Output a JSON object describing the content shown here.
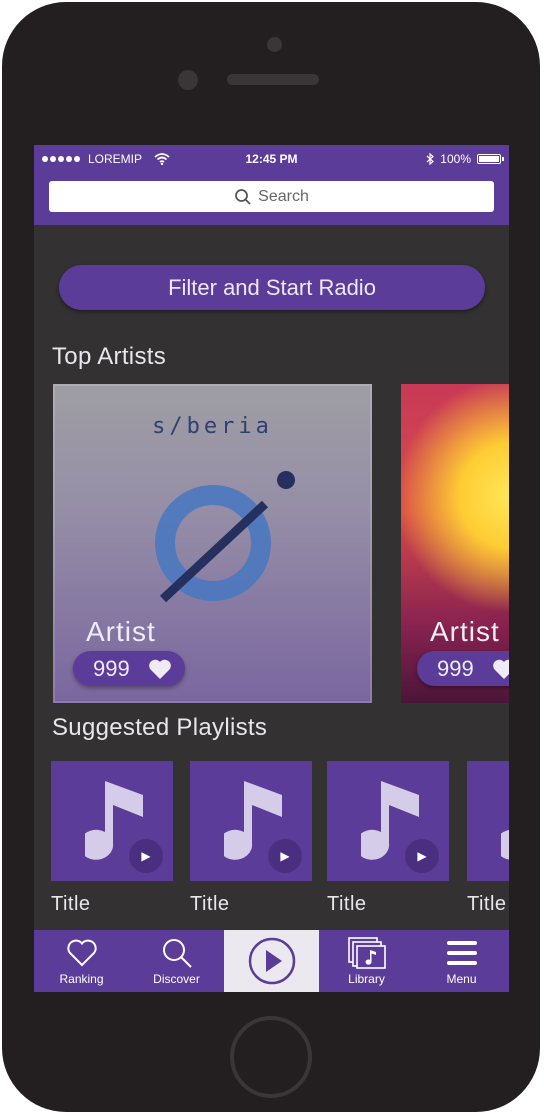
{
  "status_bar": {
    "carrier": "LOREMIP",
    "time": "12:45 PM",
    "battery": "100%",
    "battery_level": 1.0,
    "signal_bars": 5
  },
  "search": {
    "placeholder": "Search"
  },
  "filter_button": {
    "label": "Filter and Start Radio"
  },
  "top_artists": {
    "title": "Top Artists",
    "items": [
      {
        "name": "Artist",
        "likes": "999",
        "cover_text": "s/beria"
      },
      {
        "name": "Artist",
        "likes": "999"
      }
    ]
  },
  "suggested_playlists": {
    "title": "Suggested Playlists",
    "items": [
      {
        "title": "Title"
      },
      {
        "title": "Title"
      },
      {
        "title": "Title"
      },
      {
        "title": "Title"
      }
    ]
  },
  "tab_bar": {
    "items": [
      {
        "label": "Ranking",
        "icon": "heart-outline-icon"
      },
      {
        "label": "Discover",
        "icon": "search-icon"
      },
      {
        "label": "",
        "icon": "play-circle-icon",
        "active": true
      },
      {
        "label": "Library",
        "icon": "music-library-icon"
      },
      {
        "label": "Menu",
        "icon": "hamburger-menu-icon"
      }
    ]
  },
  "colors": {
    "accent": "#5b3c99",
    "background": "#333132",
    "device": "#231f20",
    "active_tab": "#ebe8ef"
  }
}
